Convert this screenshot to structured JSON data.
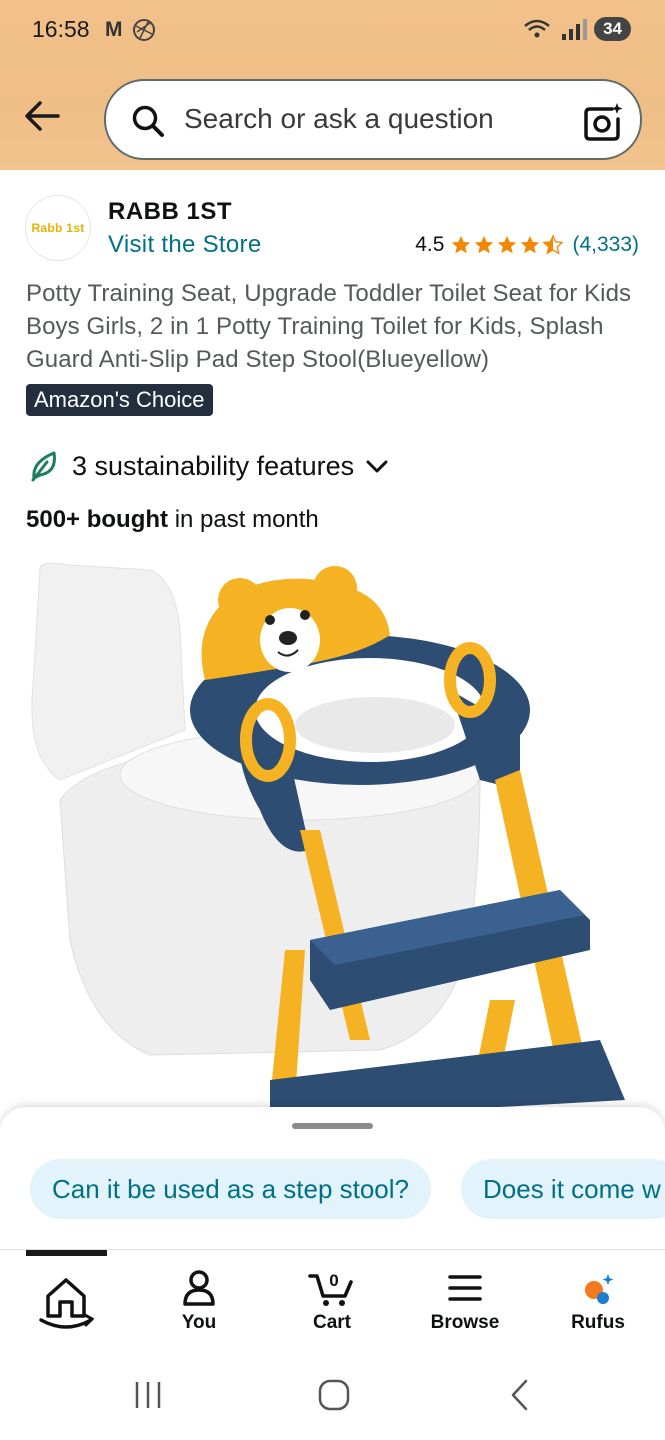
{
  "status_bar": {
    "time": "16:58",
    "gmail_icon": "M",
    "battery": "34",
    "network": "6E"
  },
  "search": {
    "placeholder": "Search or ask a question"
  },
  "brand": {
    "logo_text": "Rabb 1st",
    "name": "RABB 1ST",
    "visit_store": "Visit the Store"
  },
  "rating": {
    "value": "4.5",
    "stars": 4.5,
    "count": "(4,333)",
    "star_color": "#f08804"
  },
  "product": {
    "title": "Potty Training Seat, Upgrade Toddler Toilet Seat for Kids Boys Girls, 2 in 1 Potty Training Toilet for Kids, Splash Guard Anti-Slip Pad Step Stool(Blueyellow)",
    "badge": "Amazon's Choice",
    "sustainability": "3 sustainability features",
    "bought_bold": "500+ bought",
    "bought_rest": " in past month"
  },
  "rufus_chips": [
    {
      "label": "Can it be used as a step stool?"
    },
    {
      "label": "Does it come w"
    }
  ],
  "bottom_nav": {
    "you": "You",
    "cart": "Cart",
    "cart_count": "0",
    "browse": "Browse",
    "rufus": "Rufus"
  },
  "colors": {
    "header_bg": "#f2c089",
    "link": "#007185",
    "badge_bg": "#232f3e",
    "chip_bg": "#e2f3fb",
    "accent_orange": "#f08804"
  }
}
